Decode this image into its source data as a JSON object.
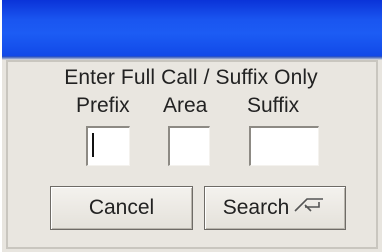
{
  "dialog": {
    "prompt": "Enter Full Call / Suffix Only",
    "labels": {
      "prefix": "Prefix",
      "area": "Area",
      "suffix": "Suffix"
    },
    "fields": {
      "prefix": "",
      "area": "",
      "suffix": ""
    },
    "buttons": {
      "cancel": "Cancel",
      "search": "Search"
    },
    "icons": {
      "search_shortcut": "enter-key-icon"
    },
    "colors": {
      "titlebar": "#1c5cf4",
      "window_bg": "#e8e5df"
    }
  }
}
